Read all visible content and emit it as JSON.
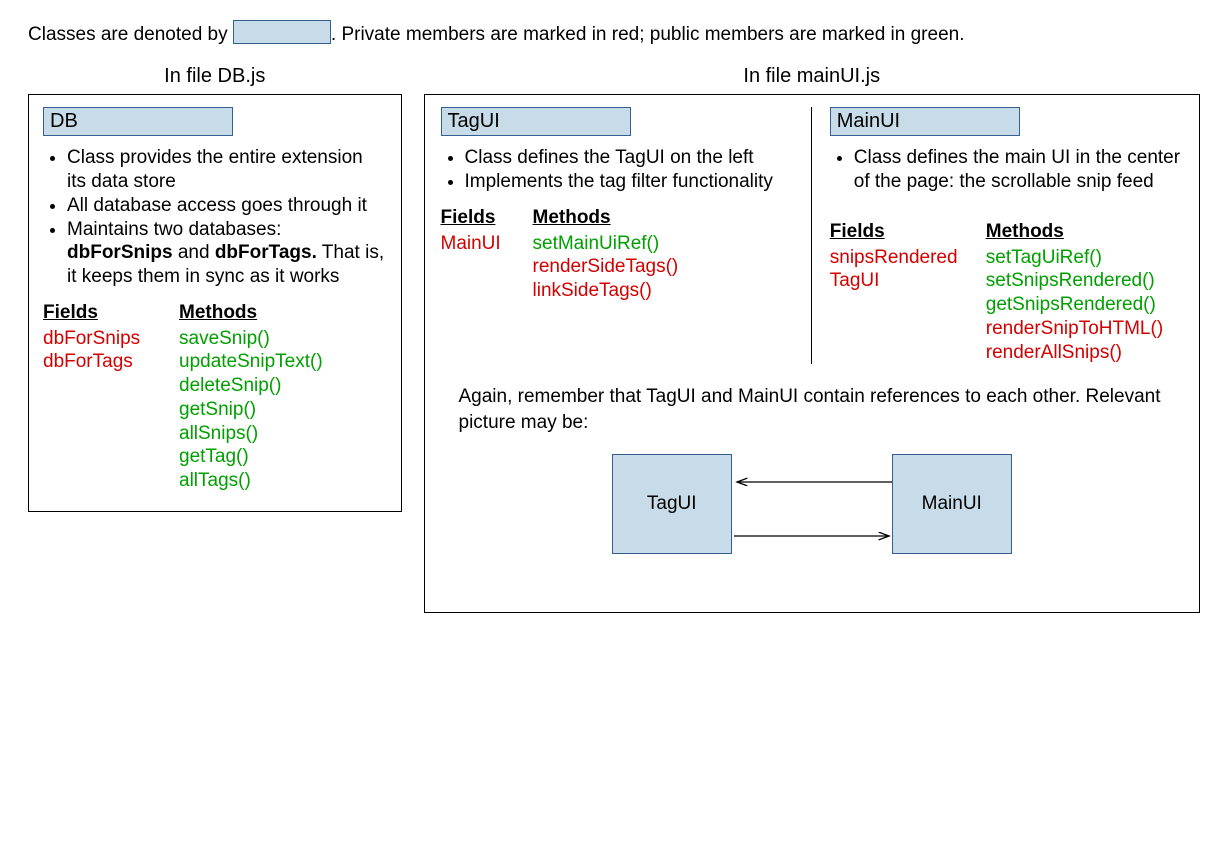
{
  "legend": {
    "text1": "Classes are denoted by ",
    "text2": ". Private members are marked in red; public members are marked in green."
  },
  "left": {
    "fileLabel": "In file DB.js",
    "class": "DB",
    "bullets": [
      "Class provides the entire extension its data store",
      "All database access goes through it"
    ],
    "bullet3_pre": "Maintains two databases: ",
    "bullet3_b1": "dbForSnips",
    "bullet3_mid": " and ",
    "bullet3_b2": "dbForTags.",
    "bullet3_post": " That is, it keeps them in sync as it works",
    "fieldsHdr": "Fields",
    "methodsHdr": "Methods",
    "fields": [
      "dbForSnips",
      "dbForTags"
    ],
    "methods": [
      "saveSnip()",
      "updateSnipText()",
      "deleteSnip()",
      "getSnip()",
      "allSnips()",
      "getTag()",
      "allTags()"
    ]
  },
  "right": {
    "fileLabel": "In file mainUI.js",
    "tagui": {
      "class": "TagUI",
      "bullets": [
        "Class defines the TagUI on the left",
        "Implements the tag filter functionality"
      ],
      "fieldsHdr": "Fields",
      "methodsHdr": "Methods",
      "fields": [
        "MainUI"
      ],
      "methods": [
        {
          "t": "setMainUiRef()",
          "c": "pub"
        },
        {
          "t": "renderSideTags()",
          "c": "priv"
        },
        {
          "t": "linkSideTags()",
          "c": "priv"
        }
      ]
    },
    "mainui": {
      "class": "MainUI",
      "bullets": [
        "Class defines the main UI in the center of the page: the scrollable snip feed"
      ],
      "fieldsHdr": "Fields",
      "methodsHdr": "Methods",
      "fields": [
        "snipsRendered",
        "TagUI"
      ],
      "methods": [
        {
          "t": "setTagUiRef()",
          "c": "pub"
        },
        {
          "t": "setSnipsRendered()",
          "c": "pub"
        },
        {
          "t": "getSnipsRendered()",
          "c": "pub"
        },
        {
          "t": "renderSnipToHTML()",
          "c": "priv"
        },
        {
          "t": "renderAllSnips()",
          "c": "priv"
        }
      ]
    },
    "note": "Again, remember that TagUI and MainUI contain references to each other. Relevant picture may be:",
    "ref": {
      "left": "TagUI",
      "right": "MainUI"
    }
  }
}
